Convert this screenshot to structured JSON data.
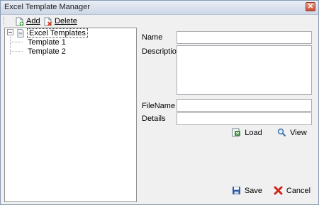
{
  "window": {
    "title": "Excel Template Manager"
  },
  "toolbar": {
    "add_label": "Add",
    "delete_label": "Delete"
  },
  "tree": {
    "root": "Excel Templates",
    "children": [
      "Template 1",
      "Template 2"
    ]
  },
  "form": {
    "name_label": "Name",
    "description_label": "Description",
    "filename_label": "FileName",
    "details_label": "Details",
    "name_value": "",
    "description_value": "",
    "filename_value": "",
    "details_value": ""
  },
  "buttons": {
    "load": "Load",
    "view": "View",
    "save": "Save",
    "cancel": "Cancel"
  },
  "icons": {
    "add": "add-document-icon",
    "delete": "delete-document-icon",
    "tree_root": "excel-file-icon",
    "load": "open-file-icon",
    "view": "magnifier-icon",
    "save": "floppy-disk-icon",
    "cancel": "red-x-icon"
  },
  "colors": {
    "titlebar": "#cdd7e6",
    "close": "#c84f33",
    "window_bg": "#f0f0f0"
  }
}
